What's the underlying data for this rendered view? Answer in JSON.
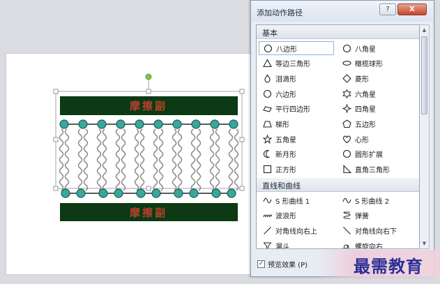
{
  "dialog": {
    "title": "添加动作路径",
    "help_label": "?",
    "close_label": "X"
  },
  "slide": {
    "top_band_label": "摩擦副",
    "bottom_band_label": "摩擦副",
    "colors": {
      "band": "#0b3a14",
      "bead": "#3aa79b",
      "bead_stroke": "#1c5d57"
    }
  },
  "sections": {
    "basic": "基本",
    "lines_curves": "直线和曲线"
  },
  "basic_left": [
    {
      "label": "八边形",
      "icon": "octagon-icon",
      "selected": true
    },
    {
      "label": "等边三角形",
      "icon": "triangle-icon"
    },
    {
      "label": "泪滴形",
      "icon": "teardrop-icon"
    },
    {
      "label": "六边形",
      "icon": "hexagon-icon"
    },
    {
      "label": "平行四边形",
      "icon": "parallelogram-icon"
    },
    {
      "label": "梯形",
      "icon": "trapezoid-icon"
    },
    {
      "label": "五角星",
      "icon": "star5-icon"
    },
    {
      "label": "新月形",
      "icon": "crescent-icon"
    },
    {
      "label": "正方形",
      "icon": "square-icon"
    }
  ],
  "basic_right": [
    {
      "label": "八角星",
      "icon": "star8-icon"
    },
    {
      "label": "橄榄球形",
      "icon": "football-icon"
    },
    {
      "label": "菱形",
      "icon": "diamond-icon"
    },
    {
      "label": "六角星",
      "icon": "star6-icon"
    },
    {
      "label": "四角星",
      "icon": "star4-icon"
    },
    {
      "label": "五边形",
      "icon": "pentagon-icon"
    },
    {
      "label": "心形",
      "icon": "heart-icon"
    },
    {
      "label": "圆形扩展",
      "icon": "circle-icon"
    },
    {
      "label": "直角三角形",
      "icon": "right-triangle-icon"
    }
  ],
  "curves_left": [
    {
      "label": "S 形曲线 1",
      "icon": "s-curve-icon"
    },
    {
      "label": "波浪形",
      "icon": "wave-icon"
    },
    {
      "label": "对角线向右上",
      "icon": "diagonal-up-icon"
    },
    {
      "label": "漏斗",
      "icon": "funnel-icon"
    }
  ],
  "curves_right": [
    {
      "label": "S 形曲线 2",
      "icon": "s-curve-icon"
    },
    {
      "label": "弹簧",
      "icon": "spring-icon"
    },
    {
      "label": "对角线向右下",
      "icon": "diagonal-down-icon"
    },
    {
      "label": "螺旋向右",
      "icon": "spiral-icon"
    }
  ],
  "footer": {
    "preview_label": "预览效果 (P)",
    "preview_checked": true
  },
  "watermark": {
    "text": "最需教育"
  }
}
